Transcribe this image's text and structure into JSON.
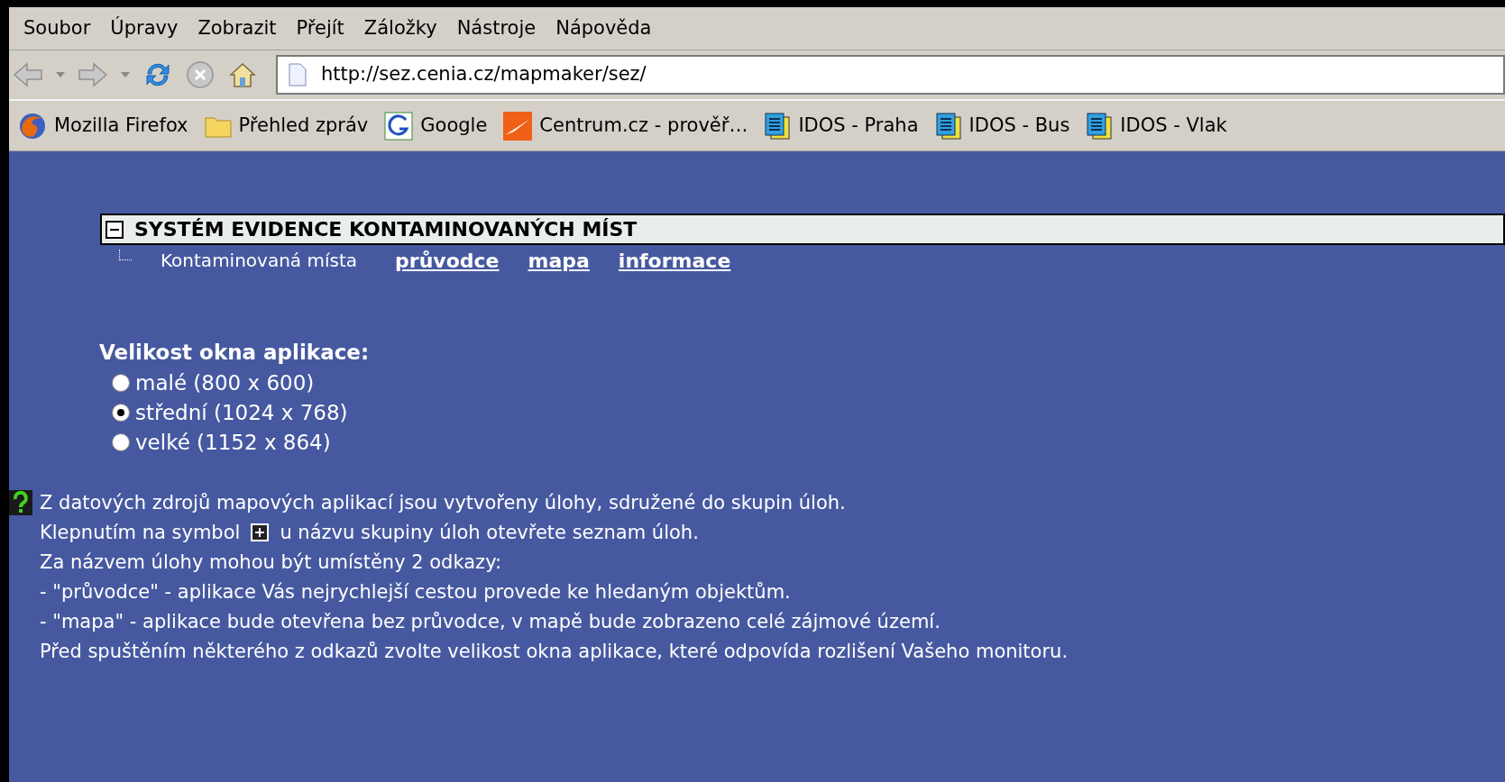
{
  "menu_bar": [
    "Soubor",
    "Úpravy",
    "Zobrazit",
    "Přejít",
    "Záložky",
    "Nástroje",
    "Nápověda"
  ],
  "address_bar": {
    "value": "http://sez.cenia.cz/mapmaker/sez/"
  },
  "bookmarks": [
    {
      "label": "Mozilla Firefox",
      "kind": "firefox"
    },
    {
      "label": "Přehled zpráv",
      "kind": "folder"
    },
    {
      "label": "Google",
      "kind": "google"
    },
    {
      "label": "Centrum.cz - prověř…",
      "kind": "centrum"
    },
    {
      "label": "IDOS - Praha",
      "kind": "idos"
    },
    {
      "label": "IDOS - Bus",
      "kind": "idos"
    },
    {
      "label": "IDOS - Vlak",
      "kind": "idos"
    }
  ],
  "tree": {
    "title": "SYSTÉM EVIDENCE KONTAMINOVANÝCH MÍST",
    "expanded": true,
    "children": [
      {
        "label": "Kontaminovaná místa",
        "links": [
          "průvodce",
          "mapa",
          "informace"
        ]
      }
    ]
  },
  "window_size": {
    "heading": "Velikost okna aplikace:",
    "options": [
      {
        "label": "malé (800 x 600)",
        "selected": false
      },
      {
        "label": "střední (1024 x 768)",
        "selected": true
      },
      {
        "label": "velké (1152 x 864)",
        "selected": false
      }
    ]
  },
  "help": {
    "line_1": "Z datových zdrojů mapových aplikací jsou vytvořeny úlohy, sdružené do skupin úloh.",
    "line_2_before": "Klepnutím na symbol",
    "line_2_after": "u názvu skupiny úloh otevřete seznam úloh.",
    "lines": [
      "Za názvem úlohy mohou být umístěny 2 odkazy:",
      "- \"průvodce\" - aplikace Vás nejrychlejší cestou provede ke hledaným objektům.",
      "- \"mapa\" - aplikace bude otevřena bez průvodce, v mapě bude zobrazeno celé zájmové území.",
      "Před spuštěním některého z odkazů zvolte velikost okna aplikace, které odpovída rozlišení Vašeho monitoru."
    ]
  }
}
